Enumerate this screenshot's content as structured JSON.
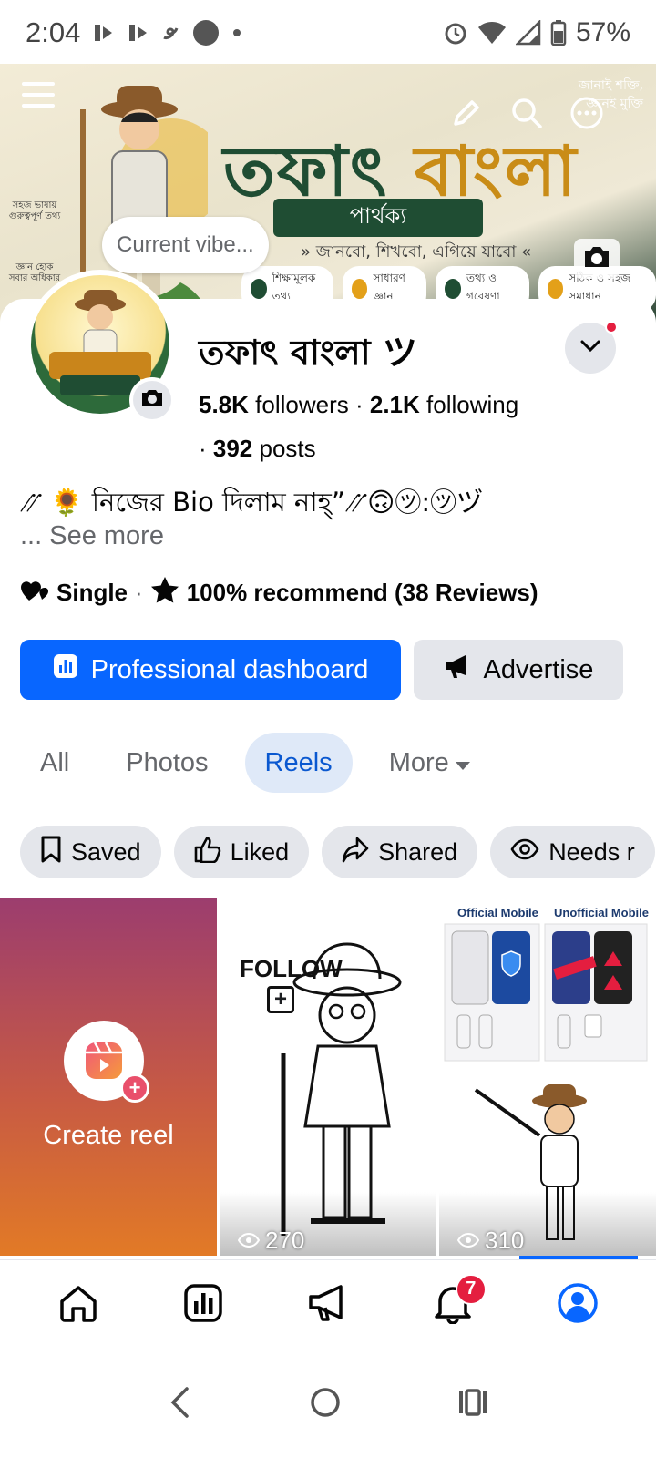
{
  "status_bar": {
    "time": "2:04",
    "battery": "57%"
  },
  "cover": {
    "title_main": "তফাৎ",
    "title_accent": "বাংলা",
    "banner": "পার্থক্য",
    "subtitle": "» জানবো, শিখবো, এগিয়ে যাবো «",
    "quote_line1": "জানাই শক্তি,",
    "quote_line2": "জ্ঞানই মুক্তি",
    "left_note1": "সহজ ভাষায় গুরুত্বপূর্ণ তথ্য",
    "left_note2": "জ্ঞান হোক সবার অধিকার",
    "chips": [
      "শিক্ষামূলক তথ্য",
      "সাধারণ জ্ঞান",
      "তথ্য ও গবেষণা",
      "সঠিক ও সহজ সমাধান"
    ]
  },
  "current_vibe_placeholder": "Current vibe...",
  "profile": {
    "name": "তফাৎ বাংলা ツ",
    "followers_count": "5.8K",
    "followers_label": "followers",
    "following_count": "2.1K",
    "following_label": "following",
    "posts_count": "392",
    "posts_label": "posts",
    "bio": "⳼ 🌻 নিজের Bio দিলাম নাহ্”⳼🙃㋡:㋡ヅ",
    "see_more": "... See more",
    "relationship": "Single",
    "recommend": "100% recommend (38 Reviews)"
  },
  "actions": {
    "primary": "Professional dashboard",
    "secondary": "Advertise"
  },
  "tabs": [
    {
      "label": "All"
    },
    {
      "label": "Photos"
    },
    {
      "label": "Reels"
    },
    {
      "label": "More"
    }
  ],
  "filter_chips": [
    {
      "label": "Saved"
    },
    {
      "label": "Liked"
    },
    {
      "label": "Shared"
    },
    {
      "label": "Needs r"
    }
  ],
  "reels": {
    "create_label": "Create reel",
    "reel1_overlay": "FOLLOW",
    "reel1_views": "270",
    "reel2_left_header": "Official Mobile",
    "reel2_right_header": "Unofficial Mobile",
    "reel2_views": "310"
  },
  "bottom_nav": {
    "notifications_badge": "7"
  },
  "colors": {
    "primary_blue": "#0866ff",
    "active_tab_bg": "#dfe9f8",
    "badge_red": "#e41e3f"
  },
  "icons": {
    "status": [
      "media-icon",
      "media-icon",
      "swirl-icon",
      "circle-icon",
      "alarm-icon",
      "wifi-icon",
      "signal-icon",
      "battery-icon"
    ],
    "cover": [
      "menu-icon",
      "pencil-icon",
      "search-icon",
      "more-icon",
      "camera-icon"
    ],
    "nav": [
      "home-icon",
      "dashboard-icon",
      "megaphone-icon",
      "bell-icon",
      "profile-icon"
    ]
  }
}
